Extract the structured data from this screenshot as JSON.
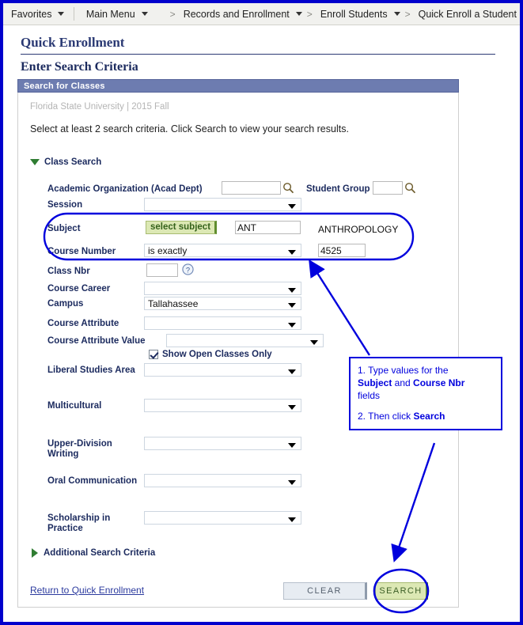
{
  "breadcrumb": {
    "items": [
      {
        "label": "Favorites",
        "has_caret": true,
        "sep_before": ""
      },
      {
        "label": "Main Menu",
        "has_caret": true,
        "sep_before": ""
      },
      {
        "label": "Records and Enrollment",
        "has_caret": true,
        "sep_before": ">"
      },
      {
        "label": "Enroll Students",
        "has_caret": true,
        "sep_before": ">"
      },
      {
        "label": "Quick Enroll a Student",
        "has_caret": false,
        "sep_before": ">"
      }
    ]
  },
  "page": {
    "title": "Quick Enrollment",
    "section_title": "Enter Search Criteria",
    "group_header": "Search for Classes",
    "context_line": "Florida State University | 2015 Fall",
    "instruction": "Select at least 2 search criteria. Click Search to view your search results."
  },
  "class_search": {
    "header": "Class Search",
    "fields": {
      "academic_org_label": "Academic Organization (Acad Dept)",
      "academic_org_value": "",
      "student_group_label": "Student Group",
      "student_group_value": "",
      "session_label": "Session",
      "session_value": "",
      "subject_label": "Subject",
      "select_subject_button": "select subject",
      "subject_value": "ANT",
      "subject_description": "ANTHROPOLOGY",
      "course_number_label": "Course Number",
      "course_number_operator": "is exactly",
      "course_number_value": "4525",
      "class_nbr_label": "Class Nbr",
      "class_nbr_value": "",
      "course_career_label": "Course Career",
      "course_career_value": "",
      "campus_label": "Campus",
      "campus_value": "Tallahassee",
      "course_attribute_label": "Course Attribute",
      "course_attribute_value": "",
      "course_attribute_value_label": "Course Attribute Value",
      "course_attribute_value_value": "",
      "show_open_label": "Show Open Classes Only",
      "show_open_checked": true,
      "liberal_studies_label": "Liberal Studies Area",
      "liberal_studies_value": "",
      "multicultural_label": "Multicultural",
      "multicultural_value": "",
      "upper_division_label": "Upper-Division Writing",
      "upper_division_value": "",
      "oral_comm_label": "Oral Communication",
      "oral_comm_value": "",
      "scholarship_label": "Scholarship in Practice",
      "scholarship_value": ""
    }
  },
  "additional": {
    "header": "Additional Search Criteria"
  },
  "footer": {
    "return_link": "Return to Quick Enrollment",
    "clear_button": "CLEAR",
    "search_button": "SEARCH"
  },
  "annotation": {
    "callout_line1": "1. Type values for the",
    "callout_bold1": "Subject",
    "callout_mid": " and ",
    "callout_bold2": "Course Nbr",
    "callout_line2": "fields",
    "callout_line3": "2. Then click ",
    "callout_bold3": "Search",
    "color": "#0000dd"
  },
  "icons": {
    "lookup": "magnifier-icon",
    "help": "question-mark-icon"
  }
}
